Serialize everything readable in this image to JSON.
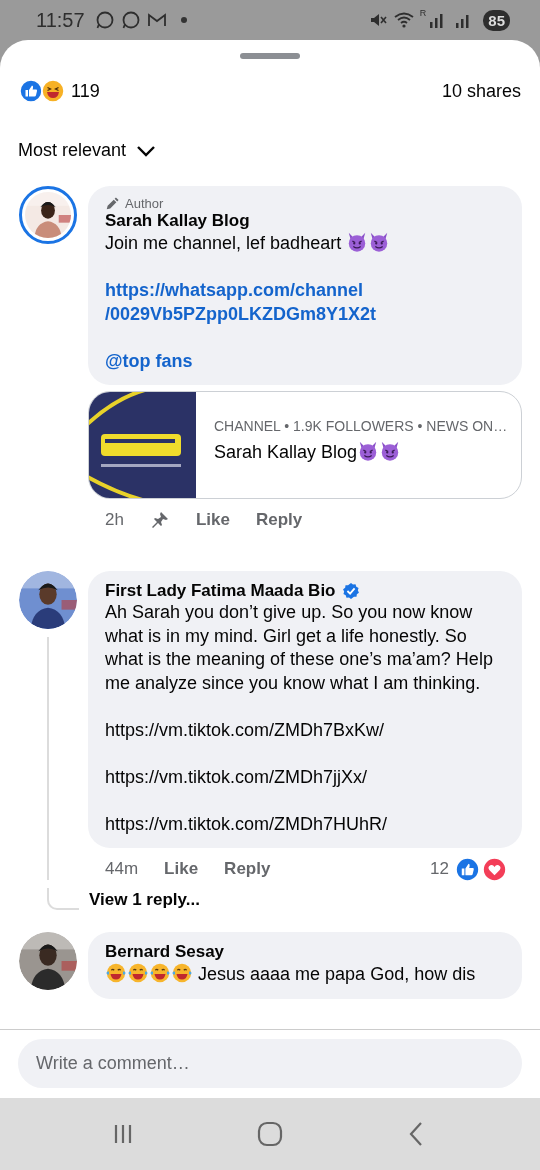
{
  "status_bar": {
    "time": "11:57",
    "roaming_label": "R",
    "battery": "85"
  },
  "summary": {
    "kind": "like_haha",
    "reaction_count": "119",
    "shares": "10 shares"
  },
  "sort": {
    "label": "Most relevant"
  },
  "comments": [
    {
      "author_badge": "Author",
      "name": "Sarah Kallay Blog",
      "verified": false,
      "avatar_ring": true,
      "paragraphs": [
        {
          "kind": "text_devils",
          "text": "Join me channel, lef badheart"
        },
        {
          "kind": "link",
          "lines": [
            "https://whatsapp.com/channel",
            "/0029Vb5PZpp0LKZDGm8Y1X2t"
          ]
        },
        {
          "kind": "link",
          "lines": [
            "@top fans"
          ]
        }
      ],
      "preview": {
        "meta": "CHANNEL • 1.9K FOLLOWERS • NEWS ON…",
        "title": "Sarah Kallay Blog",
        "kind": "title_devils"
      },
      "time": "2h",
      "pinned": true,
      "actions": [
        "Like",
        "Reply"
      ]
    },
    {
      "name": "First Lady Fatima Maada Bio",
      "verified": true,
      "avatar_ring": false,
      "paragraphs": [
        {
          "kind": "text",
          "text": "Ah Sarah you don’t give up. So you now know what is in my mind. Girl get a life honestly. So what is the meaning of these one’s  ma’am? Help me analyze since you know what I am thinking."
        },
        {
          "kind": "text",
          "text": "https://vm.tiktok.com/ZMDh7BxKw/"
        },
        {
          "kind": "text",
          "text": "https://vm.tiktok.com/ZMDh7jjXx/"
        },
        {
          "kind": "text",
          "text": "https://vm.tiktok.com/ZMDh7HUhR/"
        }
      ],
      "time": "44m",
      "pinned": false,
      "actions": [
        "Like",
        "Reply"
      ],
      "reactions": {
        "count": "12",
        "kind": "like_love"
      },
      "view_replies": "View 1 reply..."
    },
    {
      "name": "Bernard Sesay",
      "verified": false,
      "avatar_ring": false,
      "paragraphs": [
        {
          "kind": "laughing_text",
          "text": "Jesus aaaa me papa God, how dis"
        }
      ]
    }
  ],
  "composer": {
    "placeholder": "Write a comment…"
  }
}
